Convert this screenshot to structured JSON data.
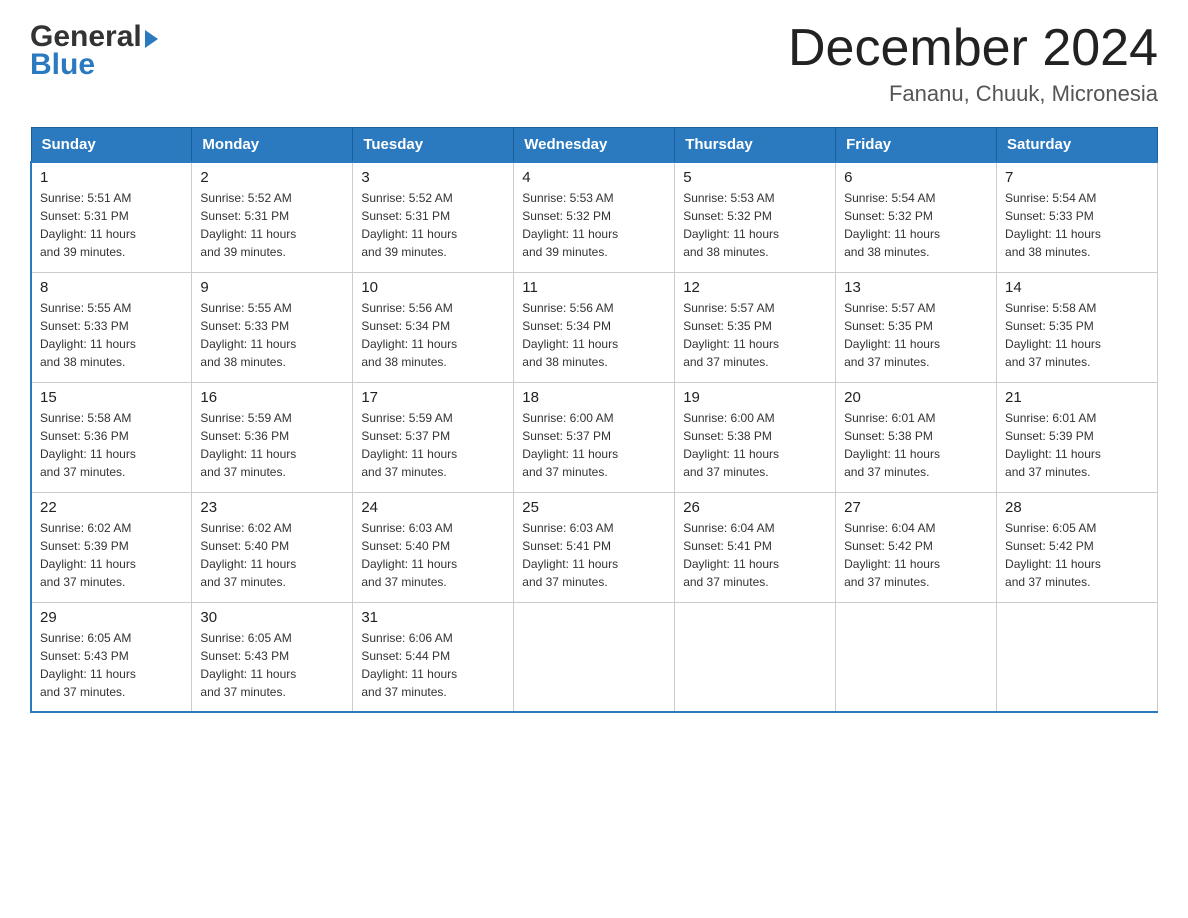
{
  "header": {
    "logo": {
      "part1": "General",
      "part2": "Blue"
    },
    "title": "December 2024",
    "subtitle": "Fananu, Chuuk, Micronesia"
  },
  "days_of_week": [
    "Sunday",
    "Monday",
    "Tuesday",
    "Wednesday",
    "Thursday",
    "Friday",
    "Saturday"
  ],
  "weeks": [
    [
      {
        "num": "1",
        "sunrise": "5:51 AM",
        "sunset": "5:31 PM",
        "daylight": "11 hours and 39 minutes."
      },
      {
        "num": "2",
        "sunrise": "5:52 AM",
        "sunset": "5:31 PM",
        "daylight": "11 hours and 39 minutes."
      },
      {
        "num": "3",
        "sunrise": "5:52 AM",
        "sunset": "5:31 PM",
        "daylight": "11 hours and 39 minutes."
      },
      {
        "num": "4",
        "sunrise": "5:53 AM",
        "sunset": "5:32 PM",
        "daylight": "11 hours and 39 minutes."
      },
      {
        "num": "5",
        "sunrise": "5:53 AM",
        "sunset": "5:32 PM",
        "daylight": "11 hours and 38 minutes."
      },
      {
        "num": "6",
        "sunrise": "5:54 AM",
        "sunset": "5:32 PM",
        "daylight": "11 hours and 38 minutes."
      },
      {
        "num": "7",
        "sunrise": "5:54 AM",
        "sunset": "5:33 PM",
        "daylight": "11 hours and 38 minutes."
      }
    ],
    [
      {
        "num": "8",
        "sunrise": "5:55 AM",
        "sunset": "5:33 PM",
        "daylight": "11 hours and 38 minutes."
      },
      {
        "num": "9",
        "sunrise": "5:55 AM",
        "sunset": "5:33 PM",
        "daylight": "11 hours and 38 minutes."
      },
      {
        "num": "10",
        "sunrise": "5:56 AM",
        "sunset": "5:34 PM",
        "daylight": "11 hours and 38 minutes."
      },
      {
        "num": "11",
        "sunrise": "5:56 AM",
        "sunset": "5:34 PM",
        "daylight": "11 hours and 38 minutes."
      },
      {
        "num": "12",
        "sunrise": "5:57 AM",
        "sunset": "5:35 PM",
        "daylight": "11 hours and 37 minutes."
      },
      {
        "num": "13",
        "sunrise": "5:57 AM",
        "sunset": "5:35 PM",
        "daylight": "11 hours and 37 minutes."
      },
      {
        "num": "14",
        "sunrise": "5:58 AM",
        "sunset": "5:35 PM",
        "daylight": "11 hours and 37 minutes."
      }
    ],
    [
      {
        "num": "15",
        "sunrise": "5:58 AM",
        "sunset": "5:36 PM",
        "daylight": "11 hours and 37 minutes."
      },
      {
        "num": "16",
        "sunrise": "5:59 AM",
        "sunset": "5:36 PM",
        "daylight": "11 hours and 37 minutes."
      },
      {
        "num": "17",
        "sunrise": "5:59 AM",
        "sunset": "5:37 PM",
        "daylight": "11 hours and 37 minutes."
      },
      {
        "num": "18",
        "sunrise": "6:00 AM",
        "sunset": "5:37 PM",
        "daylight": "11 hours and 37 minutes."
      },
      {
        "num": "19",
        "sunrise": "6:00 AM",
        "sunset": "5:38 PM",
        "daylight": "11 hours and 37 minutes."
      },
      {
        "num": "20",
        "sunrise": "6:01 AM",
        "sunset": "5:38 PM",
        "daylight": "11 hours and 37 minutes."
      },
      {
        "num": "21",
        "sunrise": "6:01 AM",
        "sunset": "5:39 PM",
        "daylight": "11 hours and 37 minutes."
      }
    ],
    [
      {
        "num": "22",
        "sunrise": "6:02 AM",
        "sunset": "5:39 PM",
        "daylight": "11 hours and 37 minutes."
      },
      {
        "num": "23",
        "sunrise": "6:02 AM",
        "sunset": "5:40 PM",
        "daylight": "11 hours and 37 minutes."
      },
      {
        "num": "24",
        "sunrise": "6:03 AM",
        "sunset": "5:40 PM",
        "daylight": "11 hours and 37 minutes."
      },
      {
        "num": "25",
        "sunrise": "6:03 AM",
        "sunset": "5:41 PM",
        "daylight": "11 hours and 37 minutes."
      },
      {
        "num": "26",
        "sunrise": "6:04 AM",
        "sunset": "5:41 PM",
        "daylight": "11 hours and 37 minutes."
      },
      {
        "num": "27",
        "sunrise": "6:04 AM",
        "sunset": "5:42 PM",
        "daylight": "11 hours and 37 minutes."
      },
      {
        "num": "28",
        "sunrise": "6:05 AM",
        "sunset": "5:42 PM",
        "daylight": "11 hours and 37 minutes."
      }
    ],
    [
      {
        "num": "29",
        "sunrise": "6:05 AM",
        "sunset": "5:43 PM",
        "daylight": "11 hours and 37 minutes."
      },
      {
        "num": "30",
        "sunrise": "6:05 AM",
        "sunset": "5:43 PM",
        "daylight": "11 hours and 37 minutes."
      },
      {
        "num": "31",
        "sunrise": "6:06 AM",
        "sunset": "5:44 PM",
        "daylight": "11 hours and 37 minutes."
      },
      null,
      null,
      null,
      null
    ]
  ],
  "labels": {
    "sunrise": "Sunrise:",
    "sunset": "Sunset:",
    "daylight": "Daylight:"
  }
}
